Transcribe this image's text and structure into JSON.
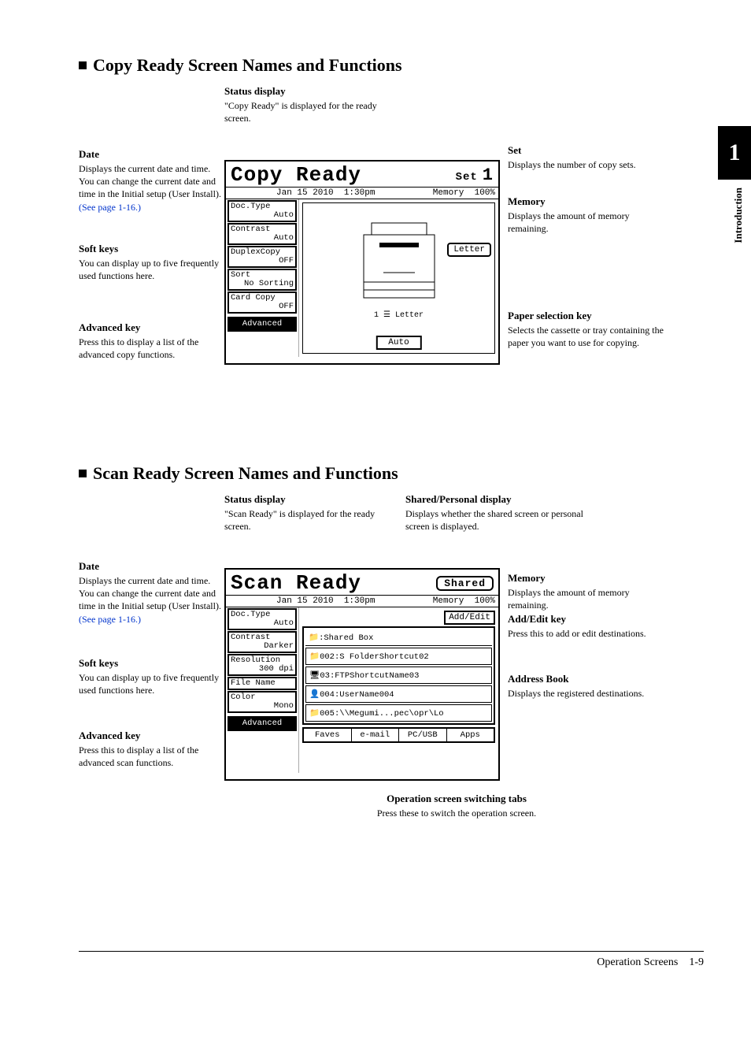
{
  "sidebar": {
    "chapter": "1",
    "label": "Introduction"
  },
  "footer": {
    "section": "Operation Screens",
    "page": "1-9"
  },
  "copy": {
    "heading": "Copy Ready Screen Names and Functions",
    "status_display": {
      "title": "Status display",
      "body": "\"Copy Ready\" is displayed for the ready screen."
    },
    "set": {
      "title": "Set",
      "body": "Displays the number of copy sets."
    },
    "date": {
      "title": "Date",
      "body": "Displays the current date and time. You can change the current date and time in the Initial setup (User Install).",
      "link": "(See page 1-16.)"
    },
    "memory": {
      "title": "Memory",
      "body": "Displays the amount of memory remaining."
    },
    "softkeys": {
      "title": "Soft keys",
      "body": "You can display up to five frequently used functions here."
    },
    "advanced": {
      "title": "Advanced key",
      "body": "Press this to display a list of the advanced copy functions."
    },
    "paper": {
      "title": "Paper selection key",
      "body": "Selects the cassette or tray containing the paper you want to use for copying."
    },
    "lcd": {
      "title": "Copy Ready",
      "set_label": "Set",
      "set_value": "1",
      "date": "Jan 15 2010",
      "time": "1:30pm",
      "mem_label": "Memory",
      "mem_value": "100%",
      "keys": [
        {
          "label": "Doc.Type",
          "value": "Auto"
        },
        {
          "label": "Contrast",
          "value": "Auto"
        },
        {
          "label": "DuplexCopy",
          "value": "OFF"
        },
        {
          "label": "Sort",
          "value": "No Sorting"
        },
        {
          "label": "Card Copy",
          "value": "OFF"
        }
      ],
      "advanced": "Advanced",
      "paper_btn": "Letter",
      "tray_text": "1 ☰ Letter",
      "auto_btn": "Auto"
    }
  },
  "scan": {
    "heading": "Scan Ready Screen Names and Functions",
    "status_display": {
      "title": "Status display",
      "body": "\"Scan Ready\" is displayed for the ready screen."
    },
    "shared": {
      "title": "Shared/Personal display",
      "body": "Displays whether the shared screen or personal screen is displayed."
    },
    "date": {
      "title": "Date",
      "body": "Displays the current date and time. You can change the current date and time in the Initial setup (User Install).",
      "link": "(See page 1-16.)"
    },
    "memory": {
      "title": "Memory",
      "body": "Displays the amount of memory remaining."
    },
    "addedit": {
      "title": "Add/Edit key",
      "body": "Press this to add or edit destinations."
    },
    "addressbook": {
      "title": "Address Book",
      "body": "Displays the registered destinations."
    },
    "softkeys": {
      "title": "Soft keys",
      "body": "You can display up to five frequently used functions here."
    },
    "advanced": {
      "title": "Advanced key",
      "body": "Press this to display a list of the advanced scan functions."
    },
    "tabs_callout": {
      "title": "Operation screen switching tabs",
      "body": "Press these to switch the operation screen."
    },
    "lcd": {
      "title": "Scan Ready",
      "shared_badge": "Shared",
      "date": "Jan 15 2010",
      "time": "1:30pm",
      "mem_label": "Memory",
      "mem_value": "100%",
      "addedit_btn": "Add/Edit",
      "keys": [
        {
          "label": "Doc.Type",
          "value": "Auto"
        },
        {
          "label": "Contrast",
          "value": "Darker"
        },
        {
          "label": "Resolution",
          "value": "300 dpi"
        },
        {
          "label": "File Name",
          "value": ""
        },
        {
          "label": "Color",
          "value": "Mono"
        }
      ],
      "advanced": "Advanced",
      "dest_header": ":Shared Box",
      "dest": [
        "002:S FolderShortcut02",
        "03:FTPShortcutName03",
        "004:UserName004",
        "005:\\\\Megumi...pec\\opr\\Lo"
      ],
      "tabs": [
        "Faves",
        "e-mail",
        "PC/USB",
        "Apps"
      ]
    }
  }
}
